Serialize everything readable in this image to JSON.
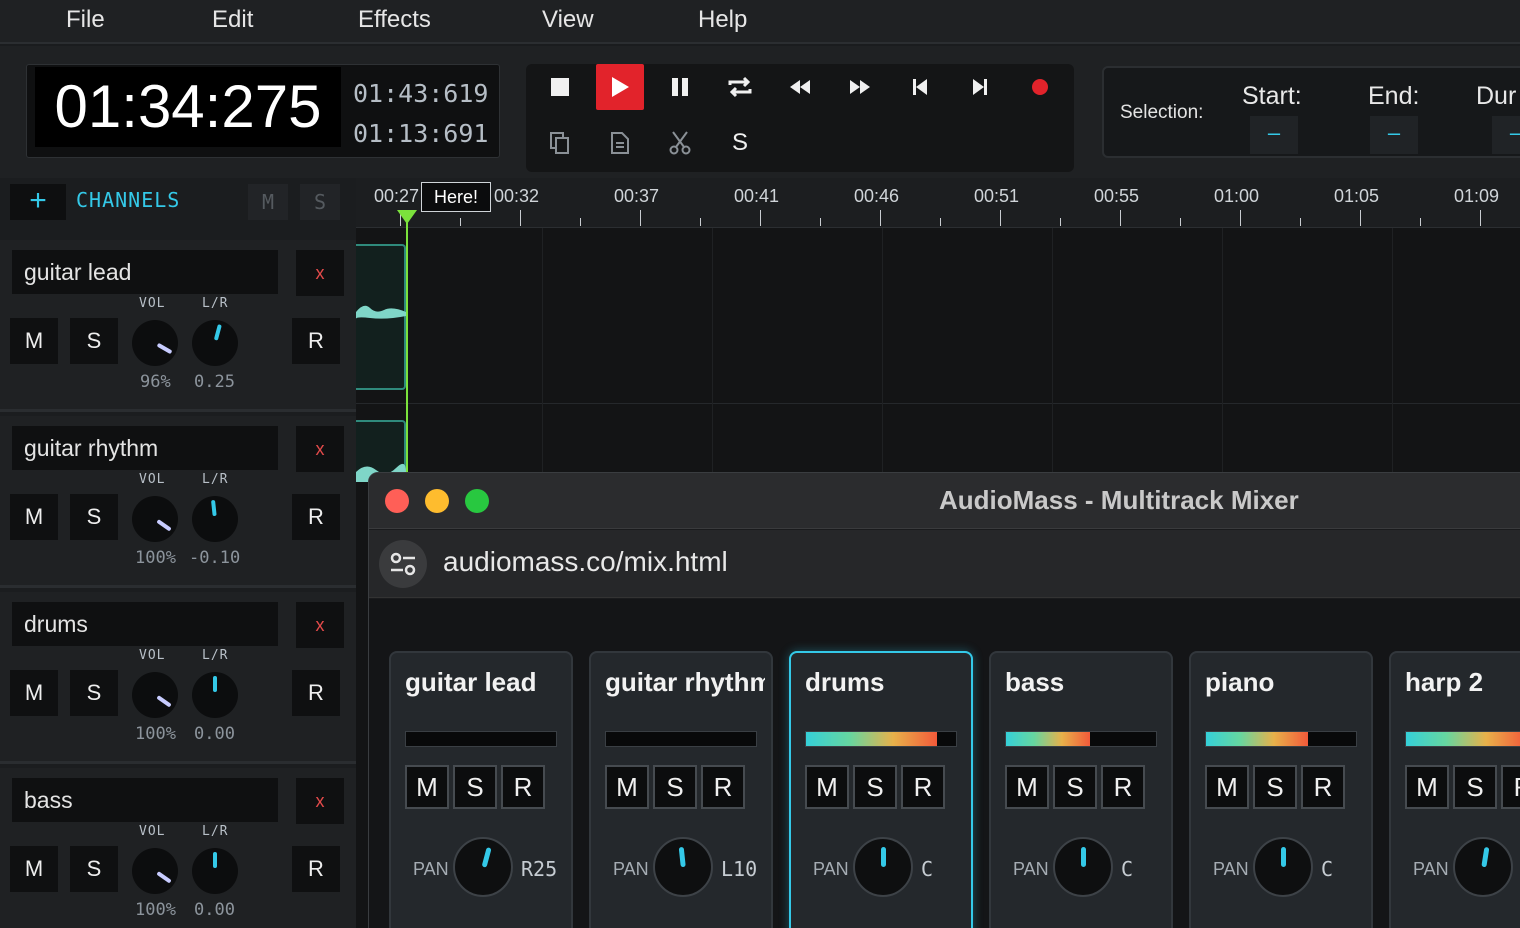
{
  "menu": [
    "File",
    "Edit",
    "Effects",
    "View",
    "Help"
  ],
  "clock": {
    "main": "01:34:275",
    "total": "01:43:619",
    "secondary": "01:13:691"
  },
  "editbar": {
    "s_label": "S"
  },
  "selection": {
    "label": "Selection:",
    "start_label": "Start:",
    "end_label": "End:",
    "dur_label": "Dur",
    "start_value": "–",
    "end_value": "–",
    "dur_value": "–"
  },
  "channels_panel": {
    "add_label": "+",
    "title": "CHANNELS",
    "m_label": "M",
    "s_label": "S"
  },
  "channels": [
    {
      "name": "guitar lead",
      "vol": "96%",
      "pan": "0.25",
      "vol_frac": 0.96,
      "pan_val": 0.25
    },
    {
      "name": "guitar rhythm",
      "vol": "100%",
      "pan": "-0.10",
      "vol_frac": 1.0,
      "pan_val": -0.1
    },
    {
      "name": "drums",
      "vol": "100%",
      "pan": "0.00",
      "vol_frac": 1.0,
      "pan_val": 0.0
    },
    {
      "name": "bass",
      "vol": "100%",
      "pan": "0.00",
      "vol_frac": 1.0,
      "pan_val": 0.0
    }
  ],
  "channel_labels": {
    "vol": "VOL",
    "lr": "L/R",
    "m": "M",
    "s": "S",
    "r": "R",
    "x": "x"
  },
  "timeline": {
    "ticks": [
      "00:27",
      "00:32",
      "00:37",
      "00:41",
      "00:46",
      "00:51",
      "00:55",
      "01:00",
      "01:05",
      "01:09"
    ],
    "marker": "Here!"
  },
  "window": {
    "title": "AudioMass - Multitrack Mixer",
    "url": "audiomass.co/mix.html"
  },
  "mixer": {
    "pan_label": "PAN",
    "strips": [
      {
        "name": "guitar lead",
        "level": 0.0,
        "pan": "R25",
        "pan_val": 0.25,
        "active": false
      },
      {
        "name": "guitar rhythm",
        "level": 0.0,
        "pan": "L10",
        "pan_val": -0.1,
        "active": false
      },
      {
        "name": "drums",
        "level": 0.87,
        "pan": "C",
        "pan_val": 0.0,
        "active": true
      },
      {
        "name": "bass",
        "level": 0.56,
        "pan": "C",
        "pan_val": 0.0,
        "active": false
      },
      {
        "name": "piano",
        "level": 0.68,
        "pan": "C",
        "pan_val": 0.0,
        "active": false
      },
      {
        "name": "harp 2",
        "level": 0.8,
        "pan": "",
        "pan_val": 0.15,
        "active": false
      }
    ]
  },
  "colors": {
    "accent": "#34c9e8",
    "play": "#e2232b",
    "playhead": "#7be23c",
    "record": "#e2232b"
  }
}
